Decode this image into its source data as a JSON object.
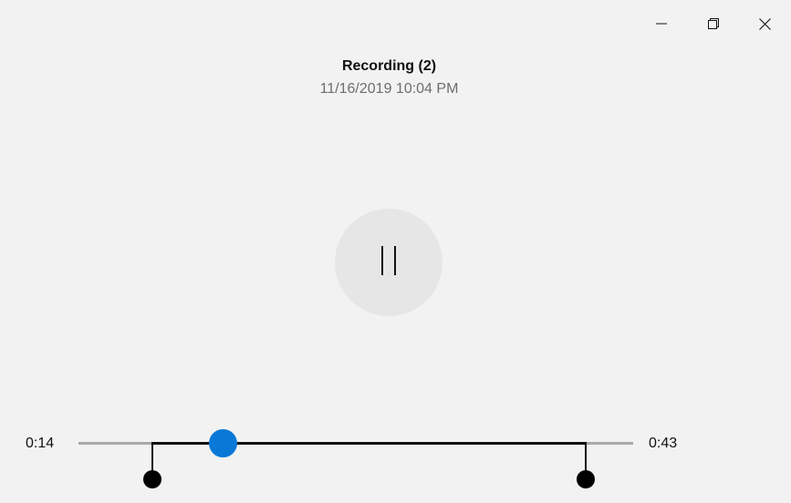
{
  "window": {
    "minimize_icon": "minimize-icon",
    "restore_icon": "restore-icon",
    "close_icon": "close-icon"
  },
  "recording": {
    "title": "Recording (2)",
    "datetime": "11/16/2019 10:04 PM"
  },
  "playback": {
    "state_icon": "pause-icon",
    "current_time": "0:14",
    "end_time": "0:43",
    "position_fraction": 0.26,
    "trim_start_fraction": 0.134,
    "trim_end_fraction": 0.915
  },
  "colors": {
    "accent": "#0a78d7",
    "background": "#f2f2f2",
    "button_bg": "#e6e6e6",
    "track": "#a9a9a9",
    "trim": "#111111"
  }
}
